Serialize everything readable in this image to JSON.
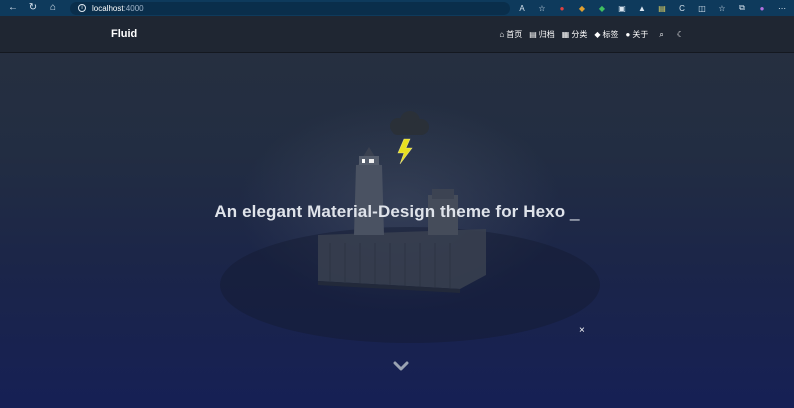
{
  "browser": {
    "url_host": "localhost",
    "url_port": ":4000",
    "icons": [
      "back-icon",
      "refresh-icon",
      "home-icon",
      "info-icon",
      "read-aloud-icon",
      "favorite-add-icon",
      "extension-red-icon",
      "extension-stack-icon",
      "extension-shield-icon",
      "extension-monitor-icon",
      "extension-triangle-icon",
      "extension-save-icon",
      "extension-c-icon",
      "split-screen-icon",
      "favorites-icon",
      "collections-icon",
      "profile-icon",
      "more-icon"
    ]
  },
  "site": {
    "brand": "Fluid",
    "menu": [
      {
        "label": "首页",
        "icon": "home-icon"
      },
      {
        "label": "归档",
        "icon": "archive-icon"
      },
      {
        "label": "分类",
        "icon": "category-icon"
      },
      {
        "label": "标签",
        "icon": "tag-icon"
      },
      {
        "label": "关于",
        "icon": "user-icon"
      }
    ],
    "search_icon": "search-icon",
    "theme_icon": "moon-icon"
  },
  "hero": {
    "headline": "An elegant Material-Design theme for Hexo",
    "cursor": "_",
    "close_symbol": "×",
    "scroll_icon": "chevron-down-icon"
  },
  "colors": {
    "navbar_bg": "#1e2430",
    "hero_bottom": "#162055",
    "lightning": "#e8e020"
  }
}
